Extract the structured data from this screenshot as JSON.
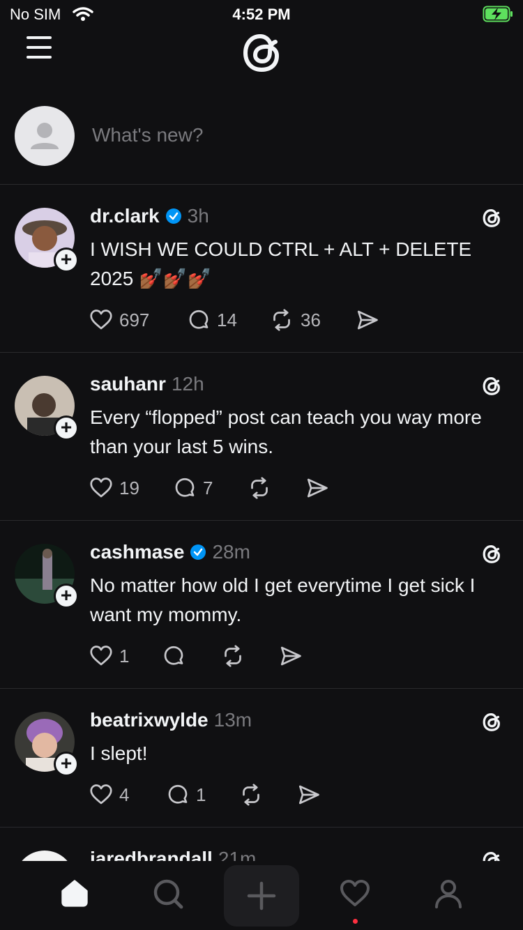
{
  "status_bar": {
    "carrier": "No SIM",
    "time": "4:52 PM"
  },
  "composer": {
    "placeholder": "What's new?"
  },
  "posts": [
    {
      "username": "dr.clark",
      "verified": true,
      "time": "3h",
      "text": "I WISH WE COULD CTRL + ALT + DELETE 2025 💅🏾💅🏾💅🏾",
      "likes": "697",
      "replies": "14",
      "reposts": "36"
    },
    {
      "username": "sauhanr",
      "verified": false,
      "time": "12h",
      "text": "Every “flopped” post can teach you way more than your last 5 wins.",
      "likes": "19",
      "replies": "7",
      "reposts": ""
    },
    {
      "username": "cashmase",
      "verified": true,
      "time": "28m",
      "text": "No matter how old I get everytime I get sick I want my mommy.",
      "likes": "1",
      "replies": "",
      "reposts": ""
    },
    {
      "username": "beatrixwylde",
      "verified": false,
      "time": "13m",
      "text": "I slept!",
      "likes": "4",
      "replies": "1",
      "reposts": ""
    },
    {
      "username": "jaredbrandall",
      "verified": false,
      "time": "21m",
      "text": "",
      "likes": "",
      "replies": "",
      "reposts": ""
    }
  ],
  "colors": {
    "background": "#101012",
    "verified": "#0095f6",
    "notification_dot": "#ff3040"
  },
  "icons": [
    "wifi-icon",
    "battery-charging-icon",
    "menu-icon",
    "threads-logo",
    "heart-icon",
    "reply-icon",
    "repost-icon",
    "share-icon",
    "verified-icon",
    "home-icon",
    "search-icon",
    "plus-icon",
    "person-icon"
  ]
}
